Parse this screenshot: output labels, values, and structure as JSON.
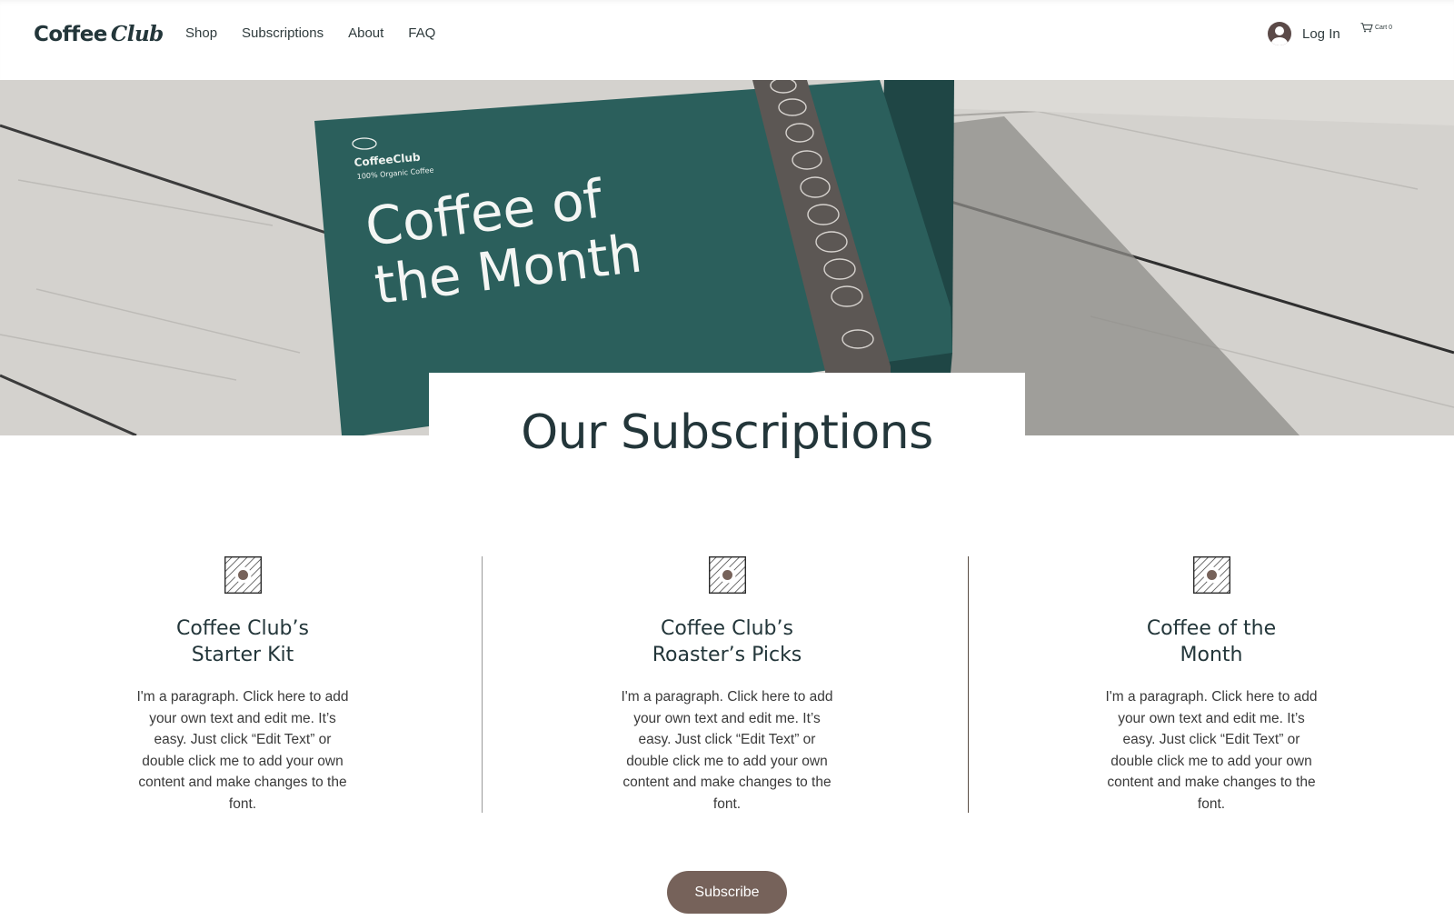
{
  "header": {
    "logo_main": "Coffee",
    "logo_script": "Club",
    "nav": [
      {
        "label": "Shop"
      },
      {
        "label": "Subscriptions"
      },
      {
        "label": "About"
      },
      {
        "label": "FAQ"
      }
    ],
    "login_label": "Log In",
    "cart_label": "Cart 0"
  },
  "hero": {
    "box_brand": "CoffeeClub",
    "box_tagline": "100% Organic Coffee",
    "box_title_line1": "Coffee of",
    "box_title_line2": "the Month"
  },
  "main": {
    "title": "Our Subscriptions",
    "columns": [
      {
        "title_line1": "Coffee Club’s",
        "title_line2": "Starter Kit",
        "text": "I'm a paragraph. Click here to add your own text and edit me. It’s easy. Just click “Edit Text” or double click me to add your own content and make changes to the font."
      },
      {
        "title_line1": "Coffee Club’s",
        "title_line2": "Roaster’s Picks",
        "text": "I'm a paragraph. Click here to add your own text and edit me. It’s easy. Just click “Edit Text” or double click me to add your own content and make changes to the font."
      },
      {
        "title_line1": "Coffee of the",
        "title_line2": "Month",
        "text": "I'm a paragraph. Click here to add your own text and edit me. It’s easy. Just click “Edit Text” or double click me to add your own content and make changes to the font."
      }
    ],
    "subscribe_label": "Subscribe"
  },
  "colors": {
    "brand_dark": "#23363a",
    "box_teal": "#2b5f5c",
    "button_brown": "#76625a"
  },
  "icons": [
    "user-avatar-icon",
    "cart-icon",
    "coffee-disc-icon"
  ]
}
